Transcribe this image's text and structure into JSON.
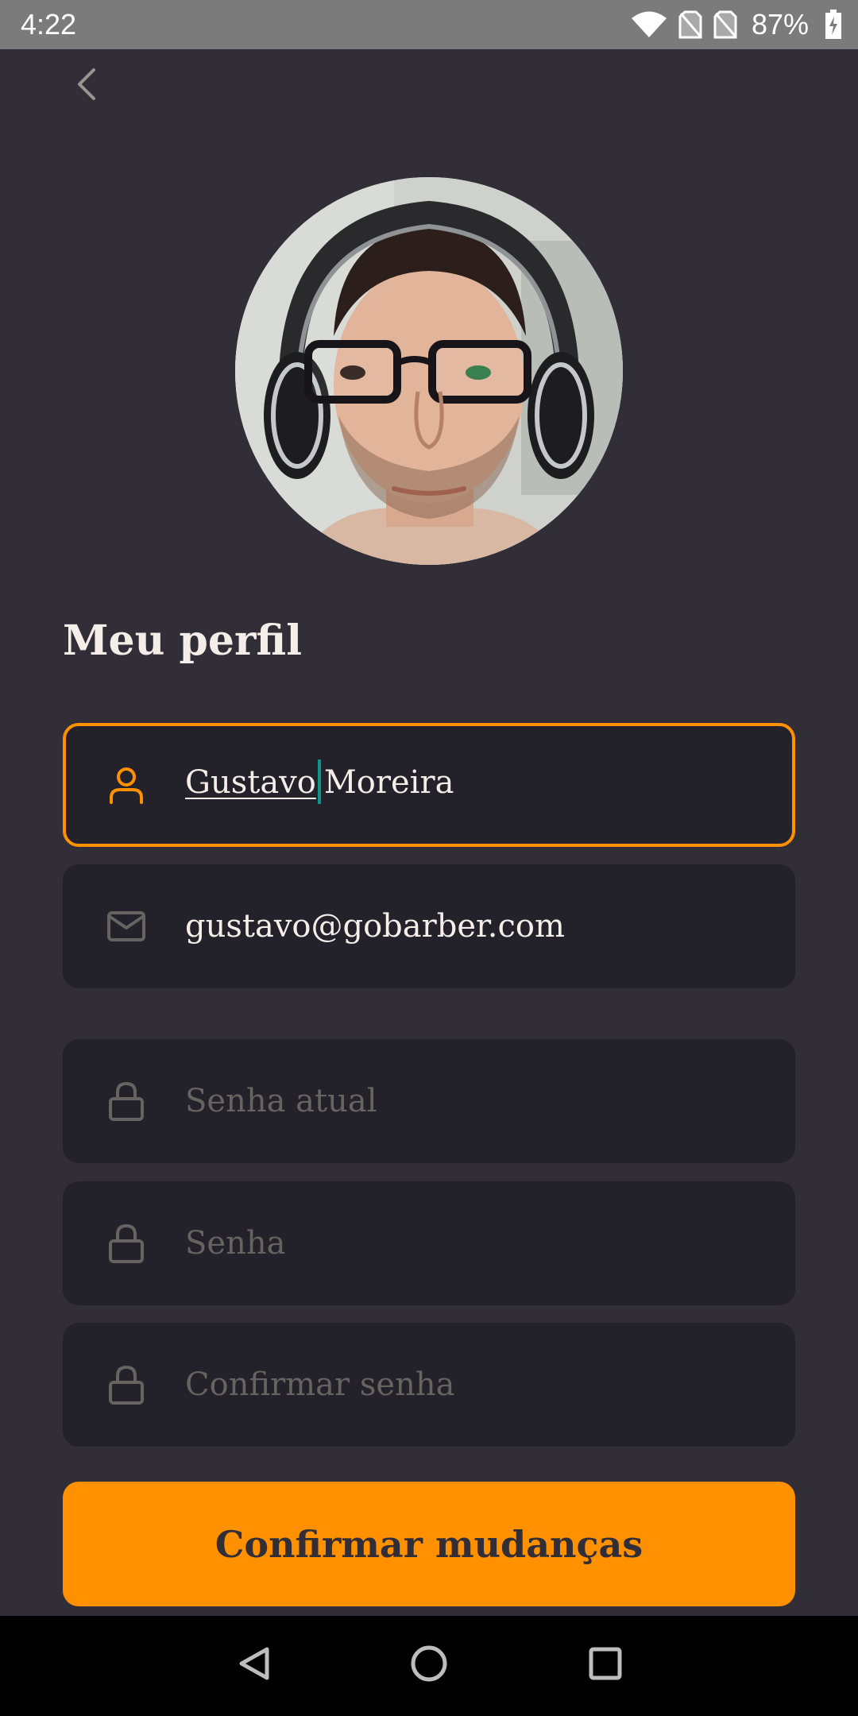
{
  "status_bar": {
    "time": "4:22",
    "battery": "87%",
    "icons": [
      "wifi-icon",
      "no-sim-icon",
      "no-sim-icon",
      "battery-charging-icon"
    ]
  },
  "header": {
    "back_icon": "chevron-left-icon"
  },
  "profile": {
    "title": "Meu perfil",
    "avatar_alt": "profile-photo"
  },
  "form": {
    "name": {
      "icon": "user-icon",
      "value_first": "Gustavo",
      "value_rest": "Moreira",
      "focused": true
    },
    "email": {
      "icon": "mail-icon",
      "value": "gustavo@gobarber.com"
    },
    "old_password": {
      "icon": "lock-icon",
      "placeholder": "Senha atual"
    },
    "password": {
      "icon": "lock-icon",
      "placeholder": "Senha"
    },
    "password_confirmation": {
      "icon": "lock-icon",
      "placeholder": "Confirmar senha"
    },
    "submit_label": "Confirmar mudanças"
  },
  "nav_bar": {
    "icons": [
      "back-triangle-icon",
      "home-circle-icon",
      "recents-square-icon"
    ]
  },
  "colors": {
    "background": "#312e38",
    "input_bg": "#232129",
    "accent": "#ff9000",
    "text": "#f4ede8",
    "placeholder": "#666360"
  }
}
